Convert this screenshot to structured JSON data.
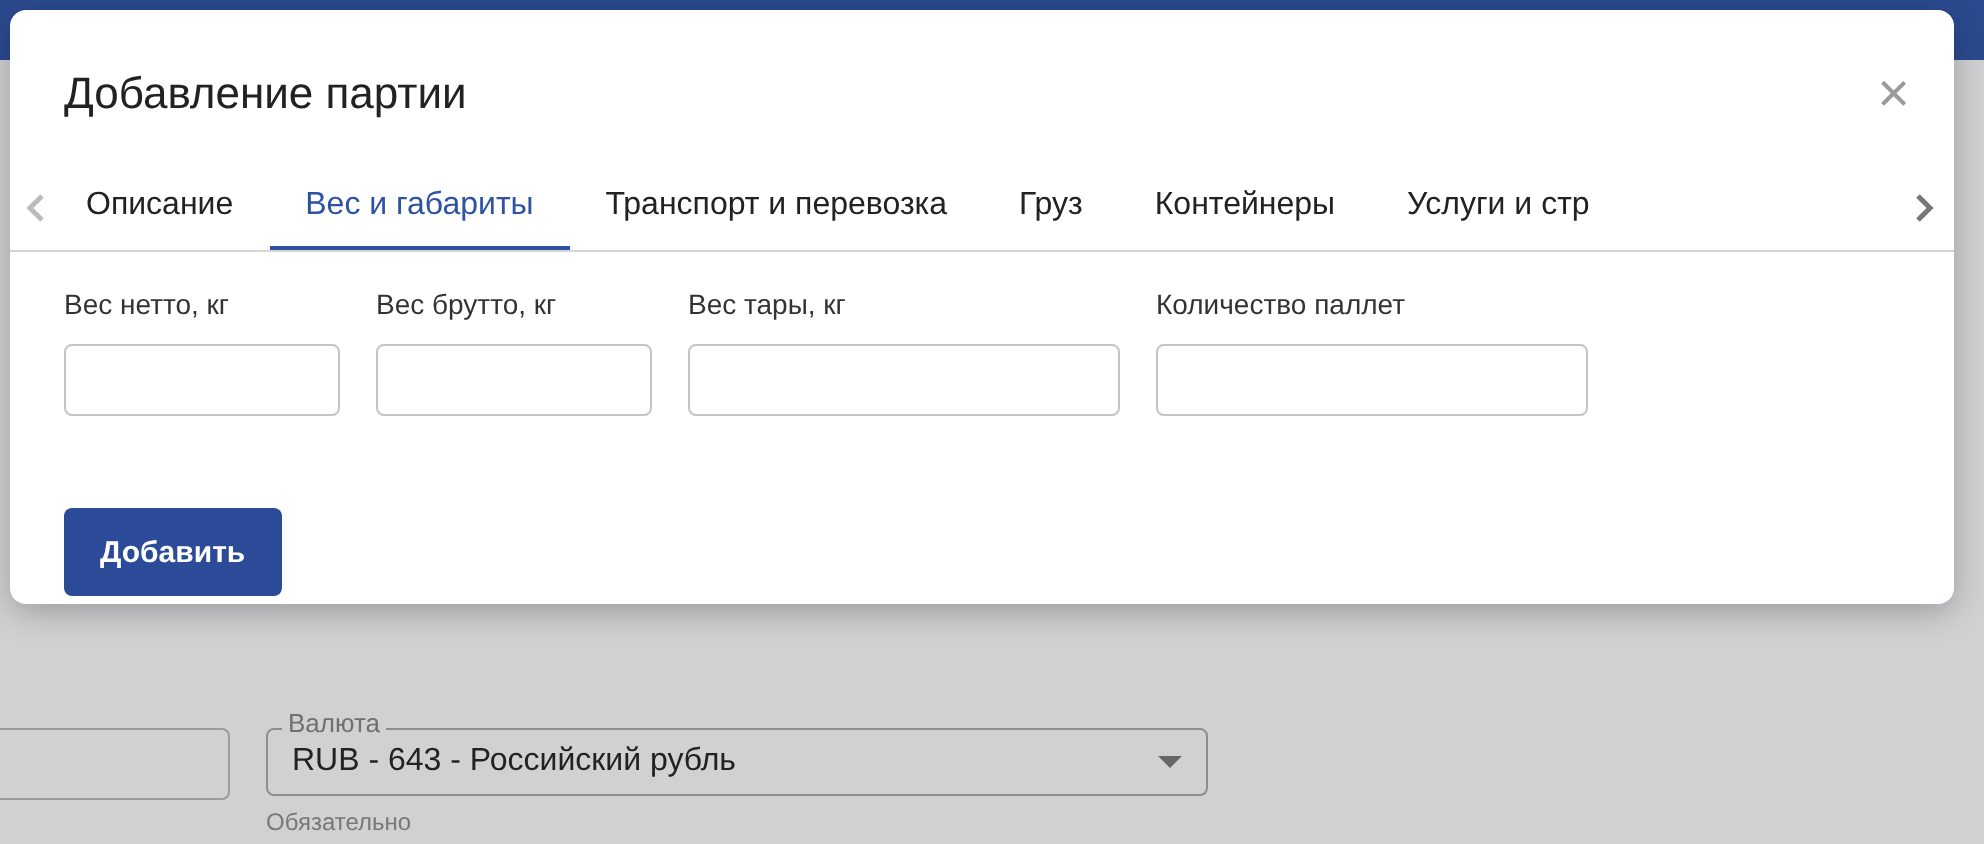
{
  "dialog": {
    "title": "Добавление партии",
    "close": "×"
  },
  "tabs": [
    {
      "label": "Описание",
      "selected": false
    },
    {
      "label": "Вес и габариты",
      "selected": true
    },
    {
      "label": "Транспорт и перевозка",
      "selected": false
    },
    {
      "label": "Груз",
      "selected": false
    },
    {
      "label": "Контейнеры",
      "selected": false
    },
    {
      "label": "Услуги и стр",
      "selected": false
    }
  ],
  "fields": [
    {
      "label": "Вес нетто, кг"
    },
    {
      "label": "Вес брутто, кг"
    },
    {
      "label": "Вес тары, кг"
    },
    {
      "label": "Количество паллет"
    }
  ],
  "submit": "Добавить",
  "background": {
    "currency": {
      "label": "Валюта",
      "value": "RUB - 643 - Российский рубль",
      "hint": "Обязательно"
    }
  }
}
